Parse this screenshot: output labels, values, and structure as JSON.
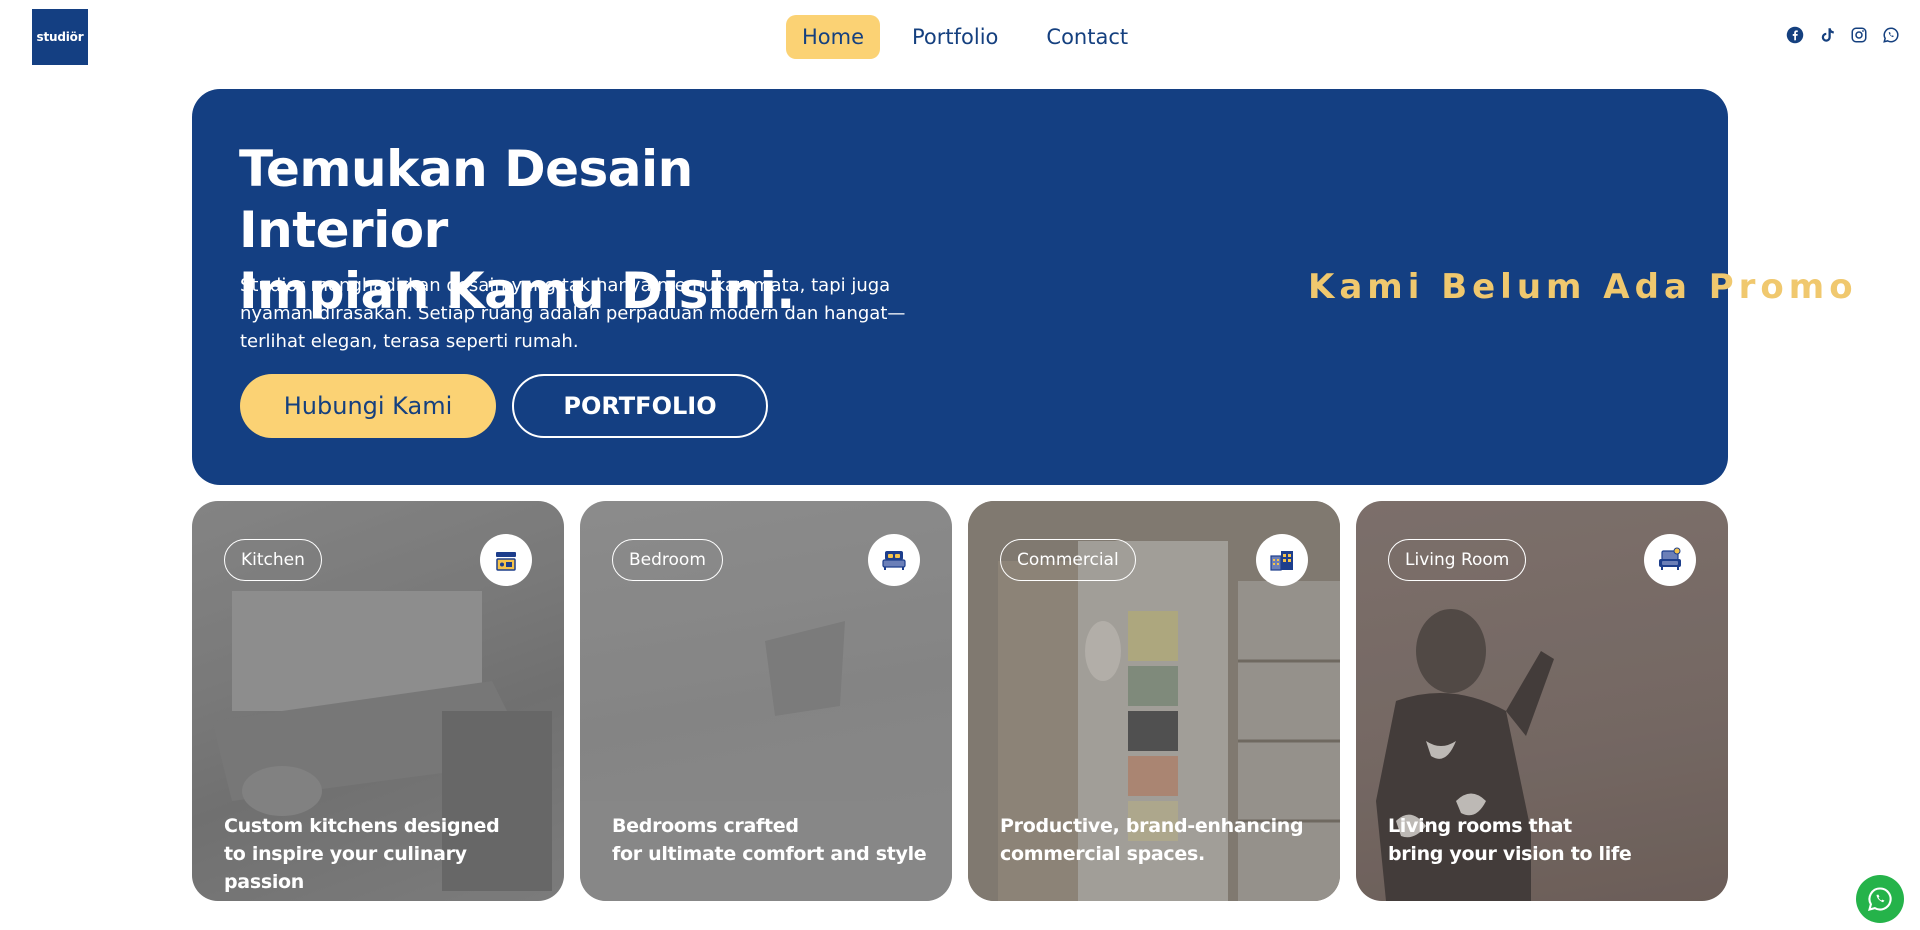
{
  "header": {
    "logo_text": "studiör",
    "nav": [
      {
        "label": "Home",
        "active": true
      },
      {
        "label": "Portfolio",
        "active": false
      },
      {
        "label": "Contact",
        "active": false
      }
    ],
    "social_icons": [
      "facebook-icon",
      "tiktok-icon",
      "instagram-icon",
      "whatsapp-icon"
    ]
  },
  "hero": {
    "title_line1": "Temukan Desain Interior",
    "title_line2": "Impian Kamu Disini.",
    "description": "Studior menghadirkan desain yang tak hanya memukau mata, tapi juga nyaman dirasakan. Setiap ruang adalah perpaduan modern dan hangat—terlihat elegan, terasa seperti rumah.",
    "primary_button": "Hubungi Kami",
    "secondary_button": "PORTFOLIO",
    "promo_text": "Kami Belum Ada Promo"
  },
  "cards": [
    {
      "tag": "Kitchen",
      "icon": "kitchen-icon",
      "line1": "Custom kitchens designed",
      "line2": "to inspire your culinary passion"
    },
    {
      "tag": "Bedroom",
      "icon": "bed-icon",
      "line1": "Bedrooms crafted",
      "line2": "for ultimate comfort and style"
    },
    {
      "tag": "Commercial",
      "icon": "commercial-building-icon",
      "line1": "Productive, brand-enhancing",
      "line2": "commercial spaces."
    },
    {
      "tag": "Living Room",
      "icon": "sofa-icon",
      "line1": "Living rooms that",
      "line2": "bring your vision to life"
    }
  ],
  "colors": {
    "brand_blue": "#143f82",
    "accent_yellow": "#fbd274",
    "promo_text": "#f0c86e",
    "whatsapp_green": "#25b34a"
  }
}
